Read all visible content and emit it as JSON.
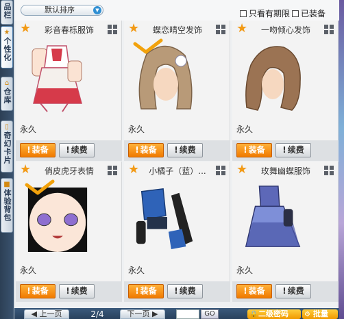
{
  "rail": {
    "tabs": [
      {
        "label": "品栏",
        "icon": "bag-icon"
      },
      {
        "label": "个性化",
        "icon": "star-icon"
      },
      {
        "label": "仓库",
        "icon": "house-icon"
      },
      {
        "label": "奇幻卡片",
        "icon": "card-icon"
      },
      {
        "label": "体验背包",
        "icon": "lock-icon"
      }
    ]
  },
  "toolbar": {
    "sort_value": "默认排序",
    "filter_expiry_label": "只看有期限",
    "filter_equipped_label": "已装备"
  },
  "items": [
    {
      "name": "彩音春栎服饰",
      "duration": "永久",
      "equipped": false
    },
    {
      "name": "蝶恋晴空发饰",
      "duration": "永久",
      "equipped": true
    },
    {
      "name": "一吻倾心发饰",
      "duration": "永久",
      "equipped": false
    },
    {
      "name": "俏皮虎牙表情",
      "duration": "永久",
      "equipped": true
    },
    {
      "name": "小橘子（蓝）...",
      "duration": "永久",
      "equipped": false
    },
    {
      "name": "玫舞幽蝶服饰",
      "duration": "永久",
      "equipped": false
    }
  ],
  "actions": {
    "equip_label": "装备",
    "renew_label": "续费"
  },
  "pagination": {
    "prev_label": "上一页",
    "next_label": "下一页",
    "page_info": "2/4",
    "go_label": "GO"
  },
  "footer": {
    "password_label": "二级密码",
    "batch_label": "批量"
  },
  "colors": {
    "accent_orange": "#f07a00",
    "star": "#f29a16",
    "check": "#f2a20c"
  }
}
